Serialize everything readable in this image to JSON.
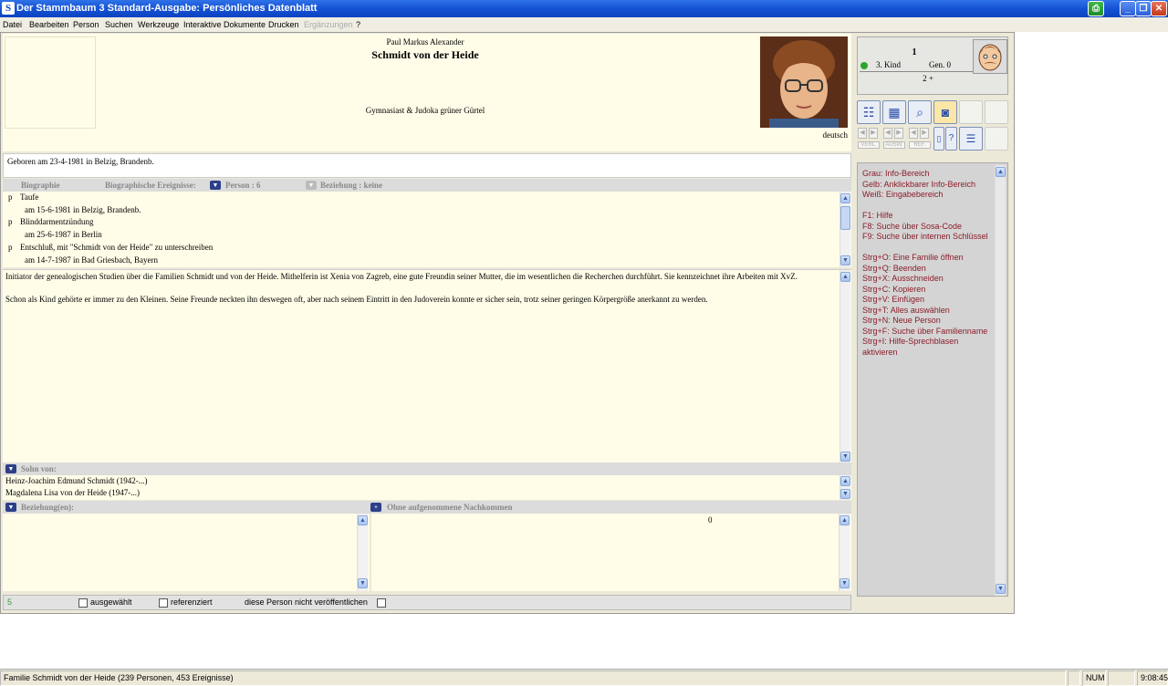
{
  "app": {
    "icon_letter": "S",
    "title": "Der Stammbaum 3 Standard-Ausgabe: Persönliches Datenblatt",
    "minimize_glyph": "_",
    "maximize_glyph": "❐",
    "close_glyph": "✕",
    "print_glyph": "⎙"
  },
  "menu": [
    "Datei",
    "Bearbeiten",
    "Person",
    "Suchen",
    "Werkzeuge",
    "Interaktive Dokumente",
    "Drucken",
    "Ergänzungen",
    "?"
  ],
  "person": {
    "first_names": "Paul Markus Alexander",
    "surname": "Schmidt von der Heide",
    "title": "Gymnasiast & Judoka grüner Gürtel",
    "language": "deutsch",
    "birth": "Geboren am 23-4-1981 in Belzig, Brandenb."
  },
  "sections": {
    "biography": "Biographie",
    "bio_events": "Biographische Ereignisse:",
    "person_count": "Person : 6",
    "relationship": "Beziehung : keine",
    "son_of": "Sohn von:",
    "relationships": "Beziehung(en):",
    "descendants": "Ohne aufgenommene Nachkommen",
    "descendants_count": "0"
  },
  "events": [
    {
      "marker": "p",
      "name": "Taufe",
      "detail": "am 15-6-1981 in Belzig, Brandenb."
    },
    {
      "marker": "p",
      "name": "Blinddarmentzündung",
      "detail": "am 25-6-1987 in Berlin"
    },
    {
      "marker": "p",
      "name": "Entschluß, mit \"Schmidt von der Heide\" zu unterschreiben",
      "detail": "am 14-7-1987 in Bad Griesbach, Bayern"
    }
  ],
  "biography_text": [
    "Initiator der genealogischen Studien über die Familien Schmidt und von der Heide. Mithelferin ist Xenia von Zagreb, eine gute Freundin seiner Mutter, die im wesentlichen die Recherchen durchführt. Sie kennzeichnet ihre Arbeiten mit XvZ.",
    "Schon als Kind gehörte er immer zu den Kleinen. Seine Freunde neckten ihn deswegen oft, aber nach seinem Eintritt in den Judoverein konnte er sicher sein, trotz seiner geringen Körpergröße anerkannt zu werden."
  ],
  "parents": [
    "Heinz-Joachim Edmund Schmidt (1942-...)",
    "Magdalena Lisa von der Heide (1947-...)"
  ],
  "infobox": {
    "number": "1",
    "child": "3. Kind",
    "generation": "Gen. 0",
    "siblings": "2 +",
    "status_color": "#2aa52a"
  },
  "toolbar": {
    "icons": [
      "family-tree",
      "pedigree",
      "search-magnifier",
      "camera",
      "blank",
      "blank"
    ],
    "icons2": [
      "person-card",
      "help",
      "list",
      "blank"
    ],
    "nav_labels": [
      "VERL.",
      "AUSW.",
      "REF."
    ]
  },
  "help_lines": [
    "Grau: Info-Bereich",
    "Gelb:  Anklickbarer Info-Bereich",
    "Weiß:  Eingabebereich",
    "",
    "F1:  Hilfe",
    "F8:  Suche über Sosa-Code",
    "F9:  Suche über internen Schlüssel",
    "",
    "Strg+O:  Eine Familie öffnen",
    "Strg+Q:  Beenden",
    "Strg+X:  Ausschneiden",
    "Strg+C:  Kopieren",
    "Strg+V:  Einfügen",
    "Strg+T:  Alles auswählen",
    "Strg+N:  Neue Person",
    "Strg+F:  Suche über Familienname",
    "Strg+I:  Hilfe-Sprechblasen aktivieren"
  ],
  "footer": {
    "count": "5",
    "selected": "ausgewählt",
    "referenced": "referenziert",
    "unpublished": "diese Person nicht veröffentlichen"
  },
  "status": {
    "text": "Familie Schmidt von der Heide (239 Personen, 453 Ereignisse)",
    "num": "NUM",
    "time": "9:08:45"
  }
}
